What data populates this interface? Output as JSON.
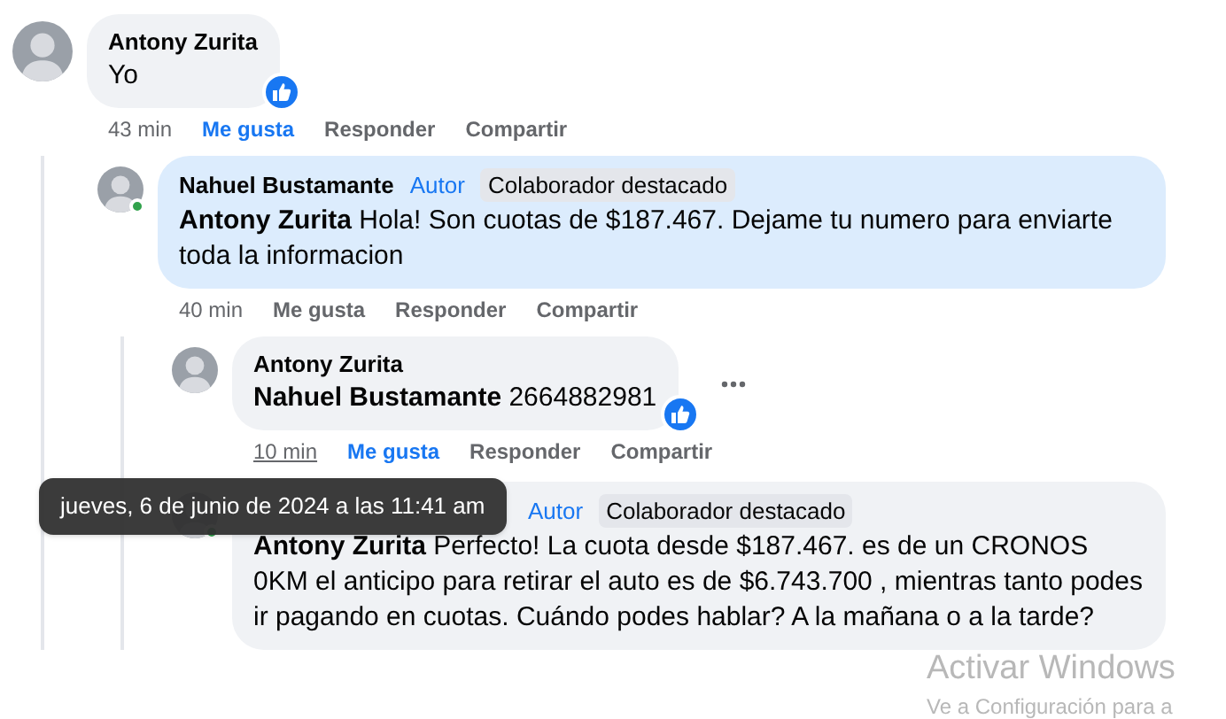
{
  "comments": [
    {
      "author": "Antony Zurita",
      "text": "Yo",
      "highlighted": false,
      "online": false,
      "reaction": true,
      "more_menu": false,
      "time": "43 min",
      "time_hovered": false,
      "liked": true,
      "actions": [
        "Me gusta",
        "Responder",
        "Compartir"
      ],
      "replies": [
        {
          "author": "Nahuel Bustamante",
          "badges": [
            {
              "label": "Autor",
              "kind": "link"
            },
            {
              "label": "Colaborador destacado",
              "kind": "chip"
            }
          ],
          "mention": "Antony Zurita",
          "text": "Hola! Son cuotas de $187.467. Dejame tu numero para enviarte toda la informacion",
          "highlighted": true,
          "online": true,
          "reaction": false,
          "more_menu": false,
          "time": "40 min",
          "time_hovered": false,
          "liked": false,
          "actions": [
            "Me gusta",
            "Responder",
            "Compartir"
          ],
          "replies": [
            {
              "author": "Antony Zurita",
              "mention": "Nahuel Bustamante",
              "text": "2664882981",
              "highlighted": false,
              "online": false,
              "reaction": true,
              "more_menu": true,
              "time": "10 min",
              "time_hovered": true,
              "liked": true,
              "actions": [
                "Me gusta",
                "Responder",
                "Compartir"
              ]
            },
            {
              "badges": [
                {
                  "label": "Autor",
                  "kind": "link"
                },
                {
                  "label": "Colaborador destacado",
                  "kind": "chip"
                }
              ],
              "mention": "Antony Zurita",
              "text": "Perfecto! La cuota desde $187.467. es de un CRONOS 0KM el anticipo para retirar el auto es de $6.743.700 , mientras tanto podes ir pagando en cuotas. Cuándo podes hablar? A la mañana o a la tarde?",
              "highlighted": false,
              "online": true,
              "reaction": false,
              "more_menu": false
            }
          ]
        }
      ]
    }
  ],
  "tooltip": "jueves, 6 de junio de 2024 a las 11:41 am",
  "os_watermark": {
    "title": "Activar Windows",
    "subtitle": "Ve a Configuración para a"
  }
}
